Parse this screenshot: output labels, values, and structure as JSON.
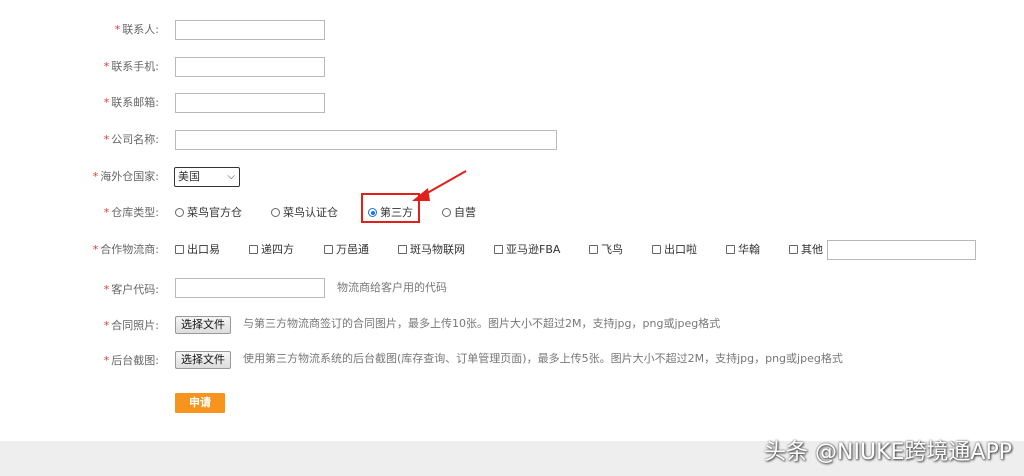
{
  "form": {
    "contact_name": {
      "label": "联系人:",
      "value": ""
    },
    "contact_phone": {
      "label": "联系手机:",
      "value": ""
    },
    "contact_email": {
      "label": "联系邮箱:",
      "value": ""
    },
    "company_name": {
      "label": "公司名称:",
      "value": ""
    },
    "warehouse_country": {
      "label": "海外仓国家:",
      "selected": "美国"
    },
    "warehouse_type": {
      "label": "仓库类型:",
      "options": [
        "菜鸟官方仓",
        "菜鸟认证仓",
        "第三方",
        "自营"
      ],
      "selected": "第三方"
    },
    "logistics_partner": {
      "label": "合作物流商:",
      "options": [
        "出口易",
        "递四方",
        "万邑通",
        "斑马物联网",
        "亚马逊FBA",
        "飞鸟",
        "出口啦",
        "华翰",
        "其他"
      ],
      "other_value": ""
    },
    "customer_code": {
      "label": "客户代码:",
      "value": "",
      "hint": "物流商给客户用的代码"
    },
    "contract_image": {
      "label": "合同照片:",
      "button": "选择文件",
      "hint": "与第三方物流商签订的合同图片，最多上传10张。图片大小不超过2M，支持jpg，png或jpeg格式"
    },
    "backend_screenshot": {
      "label": "后台截图:",
      "button": "选择文件",
      "hint": "使用第三方物流系统的后台截图(库存查询、订单管理页面)，最多上传5张。图片大小不超过2M，支持jpg，png或jpeg格式"
    },
    "submit_label": "申请"
  },
  "watermark": "头条 @NIUKE跨境通APP",
  "colors": {
    "required": "#e33",
    "submit": "#f7941d",
    "annotation": "#e0201a",
    "radio_selected": "#1a73e8"
  }
}
